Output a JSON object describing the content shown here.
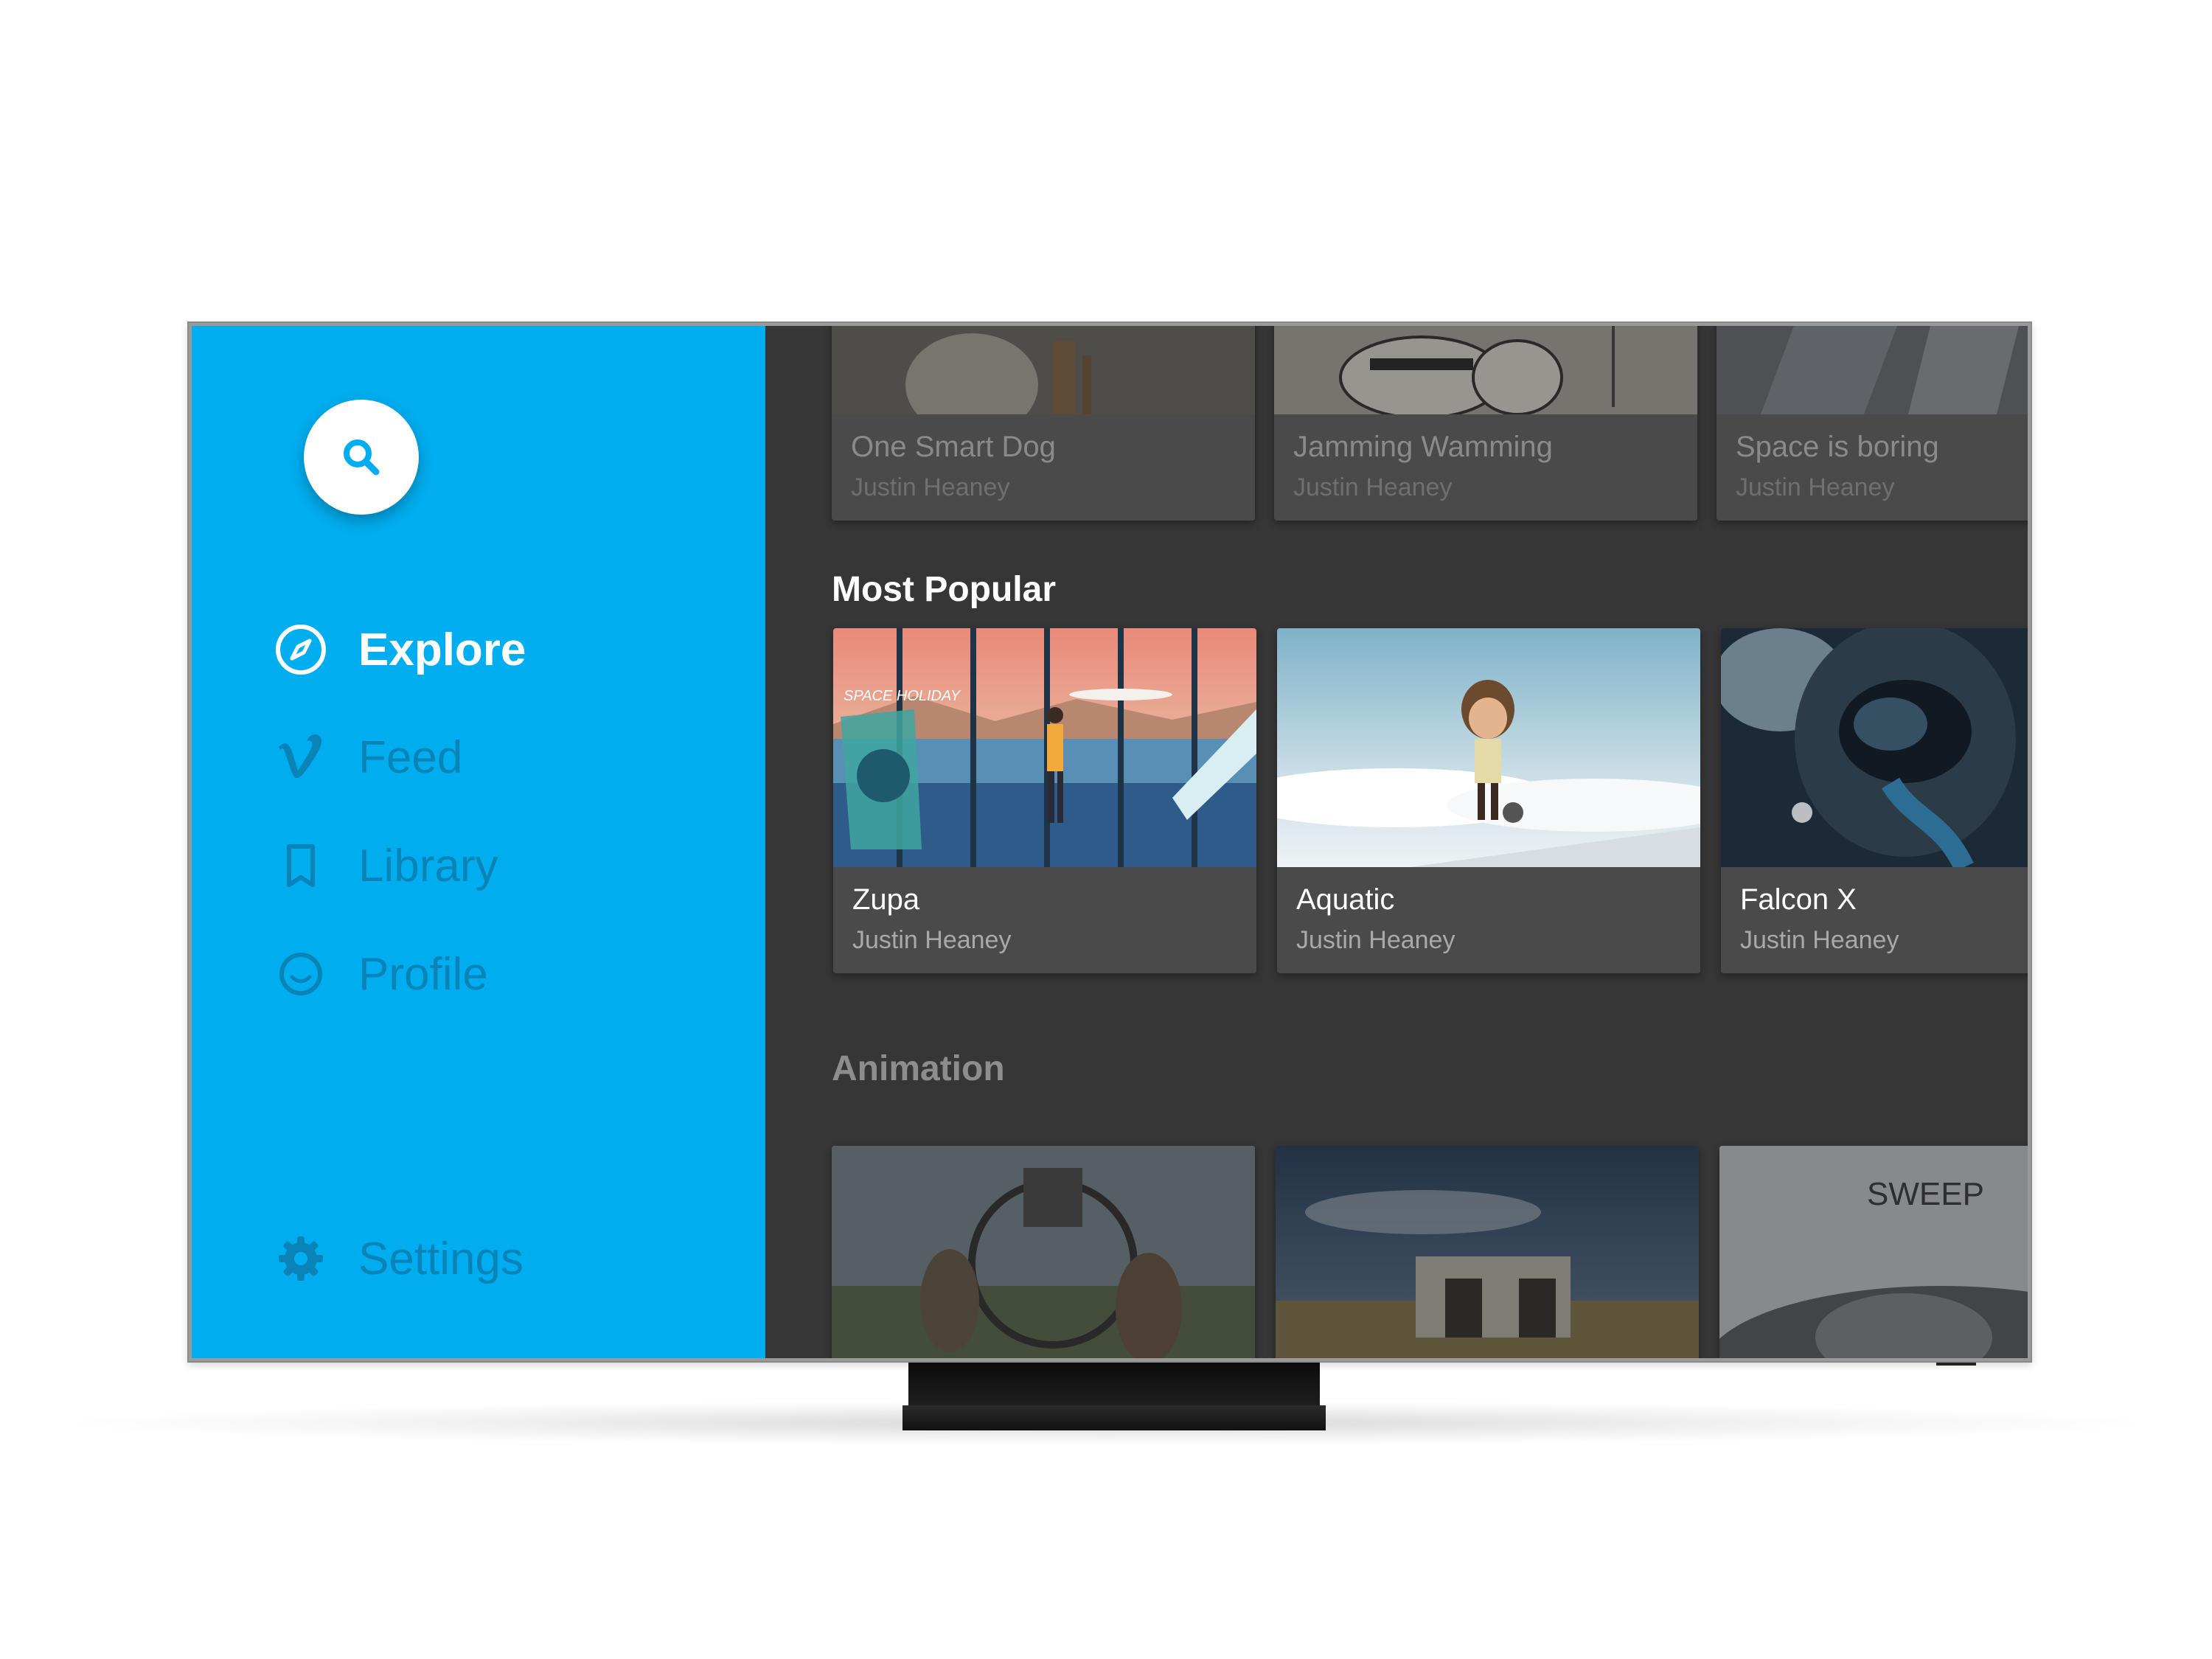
{
  "sidebar": {
    "nav": [
      {
        "label": "Explore",
        "icon": "compass-icon",
        "active": true
      },
      {
        "label": "Feed",
        "icon": "vimeo-v-icon",
        "active": false
      },
      {
        "label": "Library",
        "icon": "bookmark-icon",
        "active": false
      },
      {
        "label": "Profile",
        "icon": "smiley-icon",
        "active": false
      }
    ],
    "settings_label": "Settings"
  },
  "rows": {
    "top": {
      "items": [
        {
          "title": "One Smart Dog",
          "author": "Justin Heaney"
        },
        {
          "title": "Jamming Wamming",
          "author": "Justin Heaney"
        },
        {
          "title": "Space is boring",
          "author": "Justin Heaney"
        }
      ]
    },
    "most_popular": {
      "heading": "Most Popular",
      "items": [
        {
          "title": "Zupa",
          "author": "Justin Heaney",
          "thumb_text": "SPACE HOLIDAY"
        },
        {
          "title": "Aquatic",
          "author": "Justin Heaney"
        },
        {
          "title": "Falcon X",
          "author": "Justin Heaney"
        }
      ]
    },
    "animation": {
      "heading": "Animation",
      "items": [
        {
          "thumb_text": ""
        },
        {
          "thumb_text": ""
        },
        {
          "thumb_text": "SWEEP"
        }
      ]
    }
  },
  "colors": {
    "sidebar_bg": "#00adef",
    "nav_inactive": "#0a84b8",
    "content_bg": "#363636",
    "card_bg": "#4a4a4a"
  }
}
